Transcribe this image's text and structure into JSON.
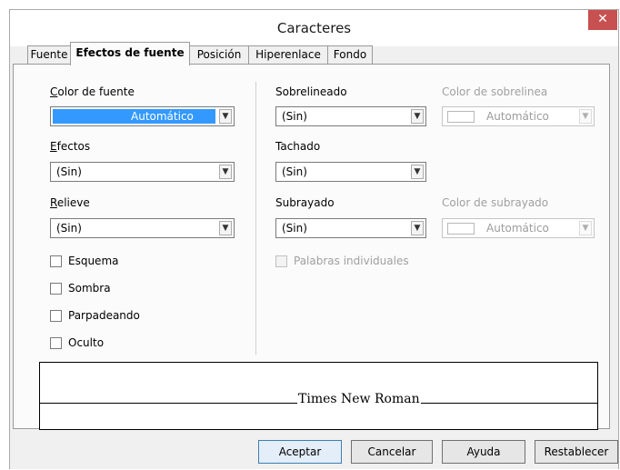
{
  "window": {
    "title": "Caracteres",
    "close_label": "✕"
  },
  "tabs": [
    "Fuente",
    "Efectos de fuente",
    "Posición",
    "Hiperenlace",
    "Fondo"
  ],
  "active_tab": "Efectos de fuente",
  "left": {
    "font_color_label": "Color de fuente",
    "font_color_value": "Automático",
    "effects_label": "Efectos",
    "effects_value": "(Sin)",
    "relief_label": "Relieve",
    "relief_value": "(Sin)",
    "checkboxes": [
      "Esquema",
      "Sombra",
      "Parpadeando",
      "Oculto"
    ]
  },
  "right": {
    "overline_label": "Sobrelineado",
    "overline_value": "(Sin)",
    "overline_color_label": "Color de sobrelinea",
    "overline_color_value": "Automático",
    "strike_label": "Tachado",
    "strike_value": "(Sin)",
    "underline_label": "Subrayado",
    "underline_value": "(Sin)",
    "underline_color_label": "Color de subrayado",
    "underline_color_value": "Automático",
    "individual_words_label": "Palabras individuales"
  },
  "preview": {
    "text": "Times New Roman"
  },
  "buttons": {
    "ok": "Aceptar",
    "cancel": "Cancelar",
    "help": "Ayuda",
    "reset": "Restablecer"
  },
  "icons": {
    "dropdown": "chevron-down-icon",
    "close": "close-icon"
  },
  "colors": {
    "selection": "#3399ff",
    "close": "#c75050"
  }
}
